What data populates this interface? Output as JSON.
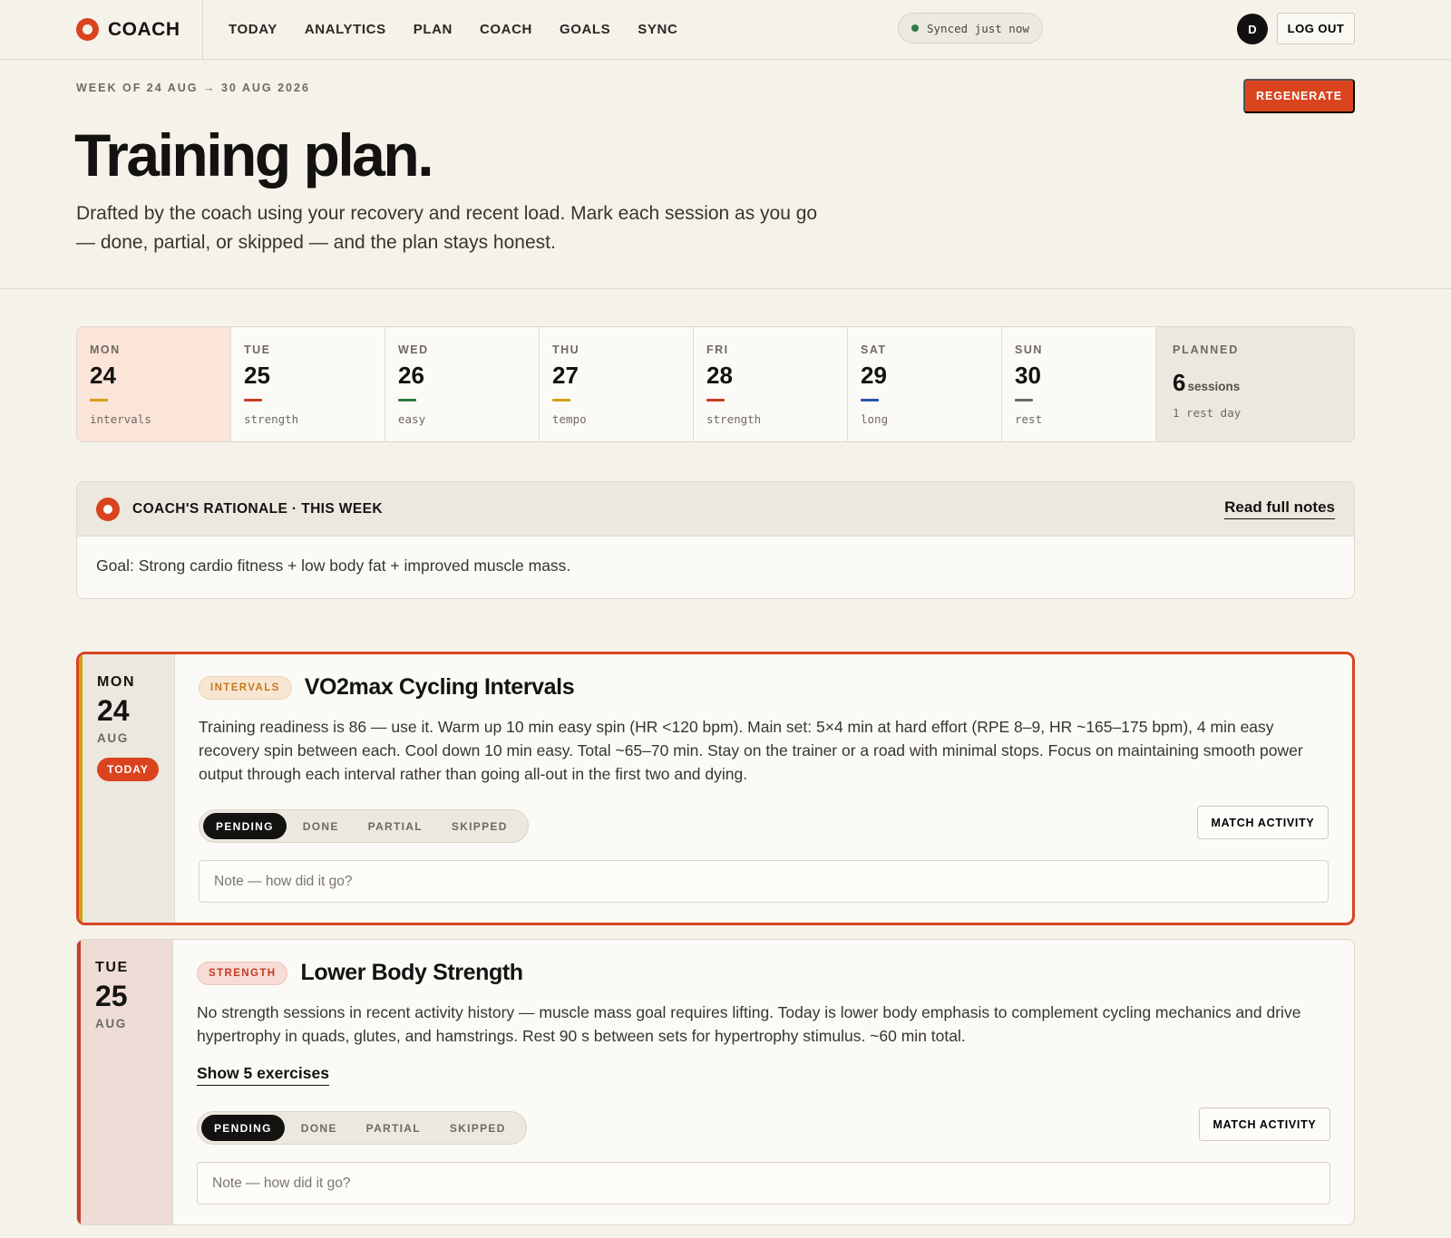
{
  "brand": {
    "name": "COACH"
  },
  "nav": [
    "TODAY",
    "ANALYTICS",
    "PLAN",
    "COACH",
    "GOALS",
    "SYNC"
  ],
  "sync": {
    "status": "Synced just now",
    "color": "#2f7a45"
  },
  "user": {
    "initial": "D",
    "logout_label": "LOG OUT"
  },
  "hero": {
    "week_label": "WEEK OF 24 AUG → 30 AUG 2026",
    "title": "Training plan.",
    "intro": "Drafted by the coach using your recovery and recent load. Mark each session as you go — done, partial, or skipped — and the plan stays honest.",
    "regenerate_label": "REGENERATE"
  },
  "week": {
    "days": [
      {
        "dow": "MON",
        "num": "24",
        "type": "intervals",
        "color": "#d4a017",
        "today": true
      },
      {
        "dow": "TUE",
        "num": "25",
        "type": "strength",
        "color": "#c93d26"
      },
      {
        "dow": "WED",
        "num": "26",
        "type": "easy",
        "color": "#2f7a45"
      },
      {
        "dow": "THU",
        "num": "27",
        "type": "tempo",
        "color": "#d4a017"
      },
      {
        "dow": "FRI",
        "num": "28",
        "type": "strength",
        "color": "#c93d26"
      },
      {
        "dow": "SAT",
        "num": "29",
        "type": "long",
        "color": "#2a55a8"
      },
      {
        "dow": "SUN",
        "num": "30",
        "type": "rest",
        "color": "#6e6a61"
      }
    ],
    "planned": {
      "label": "PLANNED",
      "count": "6",
      "unit": "sessions",
      "rest": "1 rest day"
    }
  },
  "rationale": {
    "title": "COACH'S RATIONALE · THIS WEEK",
    "link": "Read full notes",
    "body": "Goal: Strong cardio fitness + low body fat + improved muscle mass."
  },
  "sessions": [
    {
      "dow": "MON",
      "date": "24",
      "month": "AUG",
      "today_label": "TODAY",
      "tag": "INTERVALS",
      "title": "VO2max Cycling Intervals",
      "description": "Training readiness is 86 — use it. Warm up 10 min easy spin (HR <120 bpm). Main set: 5×4 min at hard effort (RPE 8–9, HR ~165–175 bpm), 4 min easy recovery spin between each. Cool down 10 min easy. Total ~65–70 min. Stay on the trainer or a road with minimal stops. Focus on maintaining smooth power output through each interval rather than going all-out in the first two and dying.",
      "status_options": [
        "PENDING",
        "DONE",
        "PARTIAL",
        "SKIPPED"
      ],
      "status_selected": "PENDING",
      "match_label": "MATCH ACTIVITY",
      "note_placeholder": "Note — how did it go?"
    },
    {
      "dow": "TUE",
      "date": "25",
      "month": "AUG",
      "tag": "STRENGTH",
      "title": "Lower Body Strength",
      "description": "No strength sessions in recent activity history — muscle mass goal requires lifting. Today is lower body emphasis to complement cycling mechanics and drive hypertrophy in quads, glutes, and hamstrings. Rest 90 s between sets for hypertrophy stimulus. ~60 min total.",
      "show_exercises": "Show 5 exercises",
      "status_options": [
        "PENDING",
        "DONE",
        "PARTIAL",
        "SKIPPED"
      ],
      "status_selected": "PENDING",
      "match_label": "MATCH ACTIVITY",
      "note_placeholder": "Note — how did it go?"
    }
  ],
  "colors": {
    "accent": "#d9441f",
    "background": "#f5f2ea",
    "ink": "#131210"
  }
}
